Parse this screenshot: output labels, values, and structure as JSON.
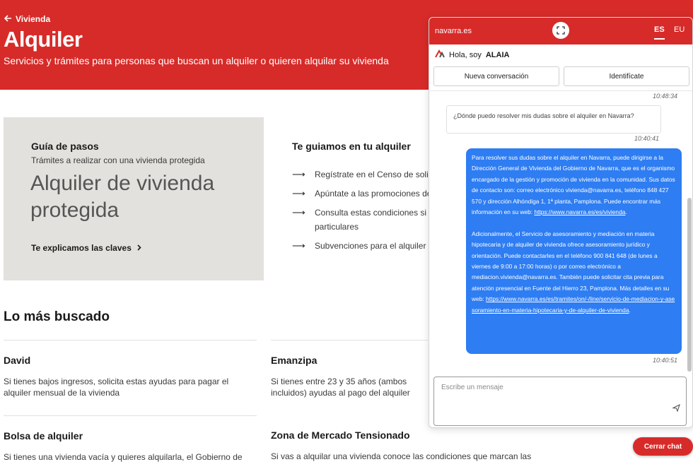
{
  "header": {
    "back_label": "Vivienda",
    "title": "Alquiler",
    "subtitle": "Servicios y trámites para personas que buscan un alquiler o quieren alquilar su vivienda"
  },
  "guide": {
    "title": "Guía de pasos",
    "subtitle": "Trámites a realizar con una vivienda protegida",
    "big_title": "Alquiler de vivienda protegida",
    "link": "Te explicamos las claves"
  },
  "steps": {
    "title": "Te guiamos en tu alquiler",
    "items": [
      "Regístrate en el Censo de solicit",
      "Apúntate a las promociones de",
      "Consulta estas condiciones si a",
      "particulares",
      "Subvenciones para el alquiler de"
    ]
  },
  "mas_buscado": {
    "title": "Lo más buscado",
    "cards": [
      {
        "title": "David",
        "desc": "Si tienes bajos ingresos, solicita estas ayudas para pagar el alquiler mensual de la vivienda"
      },
      {
        "title": "Emanzipa",
        "desc": "Si tienes entre 23 y 35 años (ambos incluidos) ayudas al pago del alquiler"
      },
      {
        "title": "Bolsa de alquiler",
        "desc": "Si tienes una vivienda vacía y quieres alquilarla, el Gobierno de"
      },
      {
        "title": "Zona de Mercado Tensionado",
        "desc": "Si vas a alquilar una vivienda conoce las condiciones que marcan las"
      }
    ]
  },
  "chat": {
    "brand": "navarra.es",
    "lang_es": "ES",
    "lang_eu": "EU",
    "greeting_prefix": "Hola, soy",
    "greeting_name": "ALAIA",
    "btn_new": "Nueva conversación",
    "btn_identify": "Identifícate",
    "time1": "10:48:34",
    "question": "¿Dónde puedo resolver mis dudas sobre el alquiler en Navarra?",
    "time2": "10:40:41",
    "answer_p1": "Para resolver sus dudas sobre el alquiler en Navarra, puede dirigirse a la Dirección General de Vivienda del Gobierno de Navarra, que es el organismo encargado de la gestión y promoción de vivienda en la comunidad. Sus datos de contacto son: correo electrónico vivienda@navarra.es, teléfono 848 427 570 y dirección Alhóndiga 1, 1ª planta, Pamplona. Puede encontrar más información en su web:",
    "answer_link1": "https://www.navarra.es/es/vivienda",
    "answer_p2": "Adicionalmente, el Servicio de asesoramiento y mediación en materia hipotecaria y de alquiler de vivienda ofrece asesoramiento jurídico y orientación. Puede contactarles en el teléfono 900 841 648 (de lunes a viernes de 9:00 a 17:00 horas) o por correo electrónico a mediacion.vivienda@navarra.es. También puede solicitar cita previa para atención presencial en Fuente del Hierro 23, Pamplona. Más detalles en su web:",
    "answer_link2": "https://www.navarra.es/es/tramites/on/-/line/servicio-de-mediacion-y-asesoramiento-en-materia-hipotecaria-y-de-alquiler-de-vivienda",
    "time3": "10:40:51",
    "input_placeholder": "Escribe un mensaje",
    "close_label": "Cerrar chat"
  },
  "colors": {
    "brand_red": "#d72b29",
    "chat_bubble_blue": "#2e7df2",
    "guide_bg": "#e3e1dd"
  }
}
